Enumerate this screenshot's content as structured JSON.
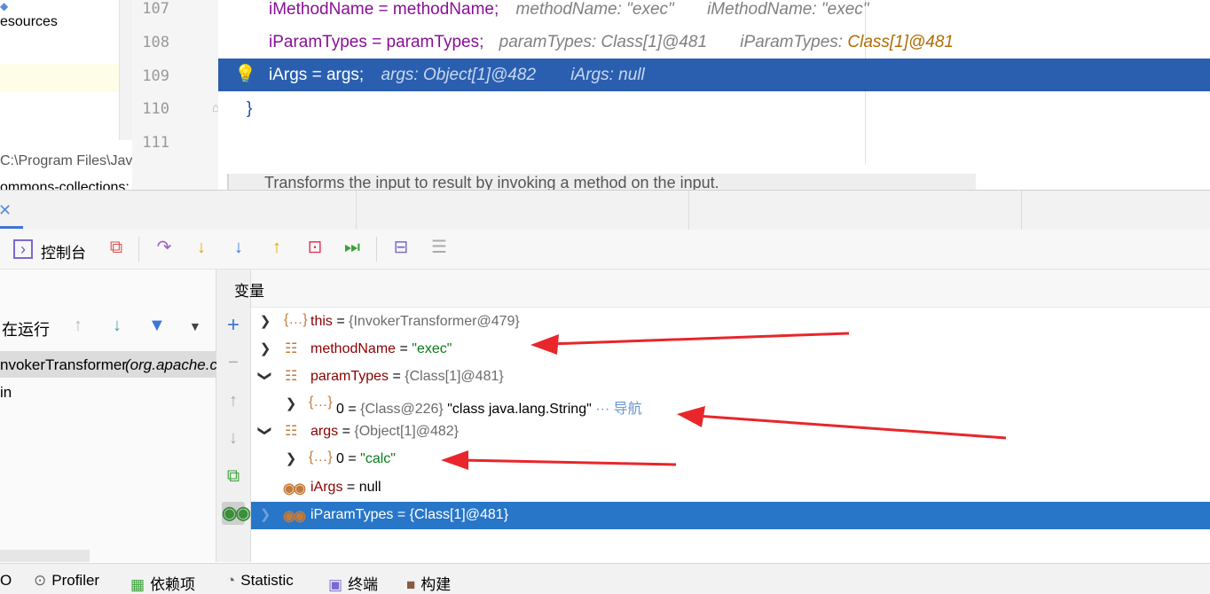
{
  "project": {
    "resources_label": "esources",
    "jdk_label": "C:\\Program Files\\Jav",
    "lib_label": "ommons-collections:"
  },
  "editor": {
    "lines": [
      {
        "num": "107",
        "code": "iMethodName = methodName;",
        "hint1": "methodName: \"exec\"",
        "hint2": "iMethodName: \"exec\""
      },
      {
        "num": "108",
        "code": "iParamTypes = paramTypes;",
        "hint1": "paramTypes: Class[1]@481",
        "hint2_label": "iParamTypes: ",
        "hint2_value": "Class[1]@481"
      },
      {
        "num": "109",
        "code": "iArgs = args;",
        "hint1": "args: Object[1]@482",
        "hint2": "iArgs: null"
      },
      {
        "num": "110",
        "code": "}"
      },
      {
        "num": "111",
        "code": ""
      }
    ],
    "doc_text": "Transforms the input to result by invoking a method on the input."
  },
  "toolbar": {
    "console_label": "控制台"
  },
  "frames": {
    "status": "在运行",
    "items": [
      "nvokerTransformer",
      "(org.apache.c",
      "in"
    ]
  },
  "variables": {
    "title": "变量",
    "rows": [
      {
        "name": "this",
        "eq": " = ",
        "value": "{InvokerTransformer@479}",
        "kind": "obj"
      },
      {
        "name": "methodName",
        "eq": " = ",
        "value": "\"exec\"",
        "kind": "field"
      },
      {
        "name": "paramTypes",
        "eq": " = ",
        "value": "{Class[1]@481}",
        "kind": "field"
      },
      {
        "name": "0",
        "eq": " = ",
        "value": "{Class@226}",
        "value2": "\"class java.lang.String\"",
        "nav": "··· 导航",
        "kind": "obj"
      },
      {
        "name": "args",
        "eq": " = ",
        "value": "{Object[1]@482}",
        "kind": "field"
      },
      {
        "name": "0",
        "eq": " = ",
        "value": "\"calc\"",
        "kind": "obj"
      },
      {
        "name": "iArgs",
        "eq": " = ",
        "value": "null",
        "kind": "watch"
      },
      {
        "name": "iParamTypes",
        "eq": " = ",
        "value": "{Class[1]@481}",
        "kind": "watch"
      }
    ]
  },
  "bottombar": {
    "items": [
      "O",
      "Profiler",
      "依赖项",
      "Statistic",
      "终端",
      "构建"
    ]
  },
  "colors": {
    "selection": "#2876c8",
    "exec_line": "#2a5fb0",
    "annotation": "#e8262b"
  }
}
